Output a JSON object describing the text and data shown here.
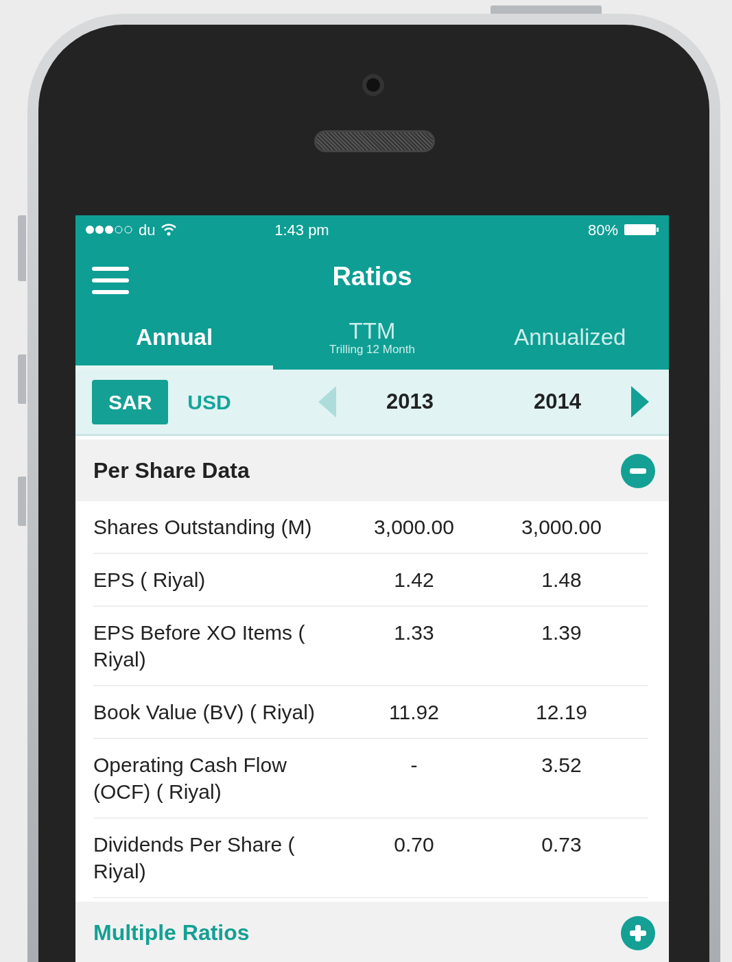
{
  "status_bar": {
    "carrier": "du",
    "time": "1:43 pm",
    "battery": "80%"
  },
  "header": {
    "title": "Ratios"
  },
  "tabs": [
    {
      "label": "Annual",
      "selected": true
    },
    {
      "label": "TTM",
      "sublabel": "Trilling 12 Month",
      "selected": false
    },
    {
      "label": "Annualized",
      "selected": false
    }
  ],
  "currencies": [
    {
      "label": "SAR",
      "selected": true
    },
    {
      "label": "USD",
      "selected": false
    }
  ],
  "year_nav": {
    "prev_disabled": true,
    "next_disabled": false,
    "years": [
      "2013",
      "2014"
    ]
  },
  "sections": [
    {
      "title": "Per Share Data",
      "expanded": true,
      "rows": [
        {
          "label": "Shares Outstanding (M)",
          "values": [
            "3,000.00",
            "3,000.00"
          ]
        },
        {
          "label": "EPS ( Riyal)",
          "values": [
            "1.42",
            "1.48"
          ]
        },
        {
          "label": "EPS Before XO Items ( Riyal)",
          "values": [
            "1.33",
            "1.39"
          ]
        },
        {
          "label": "Book Value (BV) ( Riyal)",
          "values": [
            "11.92",
            "12.19"
          ]
        },
        {
          "label": "Operating Cash Flow (OCF) ( Riyal)",
          "values": [
            "-",
            "3.52"
          ]
        },
        {
          "label": "Dividends Per Share ( Riyal)",
          "values": [
            "0.70",
            "0.73"
          ]
        }
      ]
    },
    {
      "title": "Multiple Ratios",
      "expanded": false
    }
  ]
}
